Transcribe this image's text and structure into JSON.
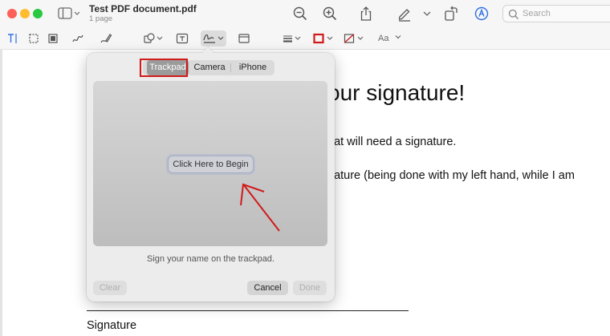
{
  "window": {
    "title": "Test PDF document.pdf",
    "subtitle": "1 page"
  },
  "toolbar": {
    "icons": [
      "zoom-out-icon",
      "zoom-in-icon",
      "share-icon",
      "highlight-pen-icon",
      "chevron-down-icon",
      "rotate-icon",
      "markup-icon"
    ],
    "search_placeholder": "Search"
  },
  "markup_toolbar": {
    "icons": [
      "text-selection-icon",
      "rectangular-selection-icon",
      "redact-icon",
      "sketch-icon",
      "draw-icon",
      "shapes-icon",
      "text-box-icon",
      "signature-icon",
      "note-icon",
      "line-style-icon",
      "border-color-icon",
      "fill-color-icon"
    ],
    "font_button": "Aa"
  },
  "document": {
    "heading": "our signature!",
    "line1": "hat will need a signature.",
    "line2": "nature (being done with my left hand, while I am",
    "signature_label": "Signature"
  },
  "signature_popover": {
    "tabs": [
      "Trackpad",
      "Camera",
      "iPhone"
    ],
    "selected_tab": "Trackpad",
    "begin_button": "Click Here to Begin",
    "hint": "Sign your name on the trackpad.",
    "clear_button": "Clear",
    "cancel_button": "Cancel",
    "done_button": "Done"
  },
  "colors": {
    "annotation_red": "#d11a1a",
    "markup_accent": "#2f6fe4"
  }
}
